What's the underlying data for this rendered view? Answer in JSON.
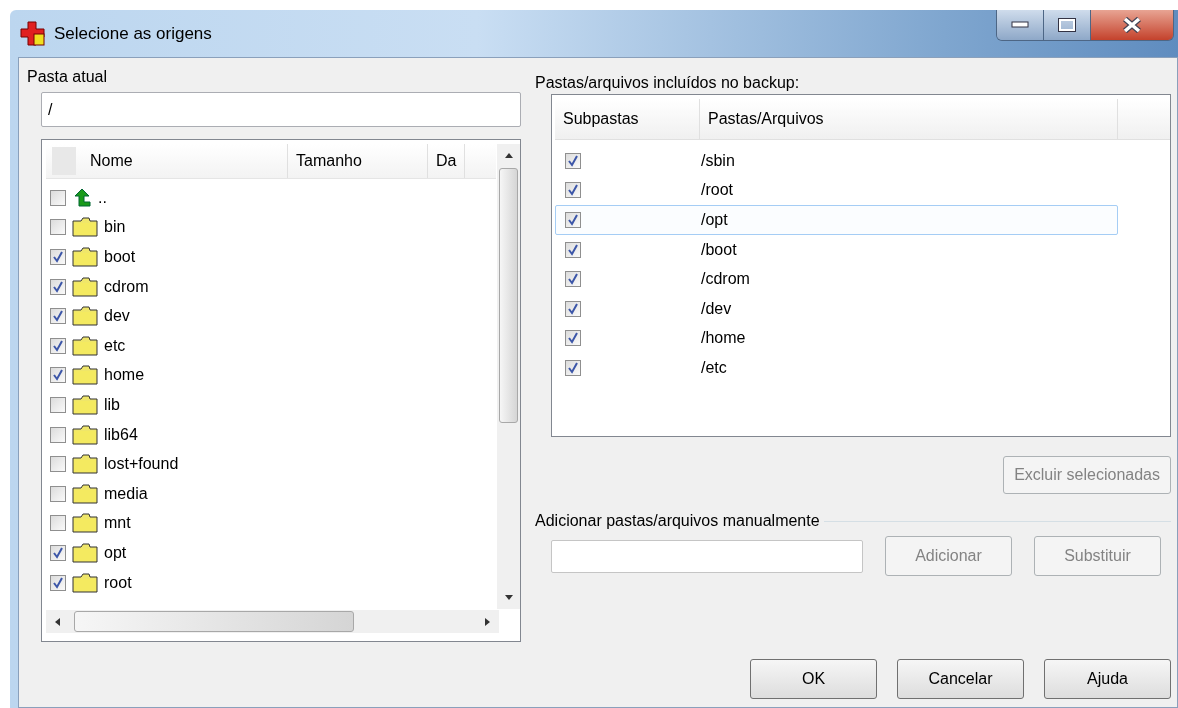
{
  "window": {
    "title": "Selecione as origens"
  },
  "current_folder": {
    "label": "Pasta atual",
    "value": "/"
  },
  "file_list": {
    "columns": [
      "Nome",
      "Tamanho",
      "Da"
    ],
    "rows": [
      {
        "kind": "parent",
        "name": "..",
        "checked": false
      },
      {
        "kind": "folder",
        "name": "bin",
        "checked": false
      },
      {
        "kind": "folder",
        "name": "boot",
        "checked": true
      },
      {
        "kind": "folder",
        "name": "cdrom",
        "checked": true
      },
      {
        "kind": "folder",
        "name": "dev",
        "checked": true
      },
      {
        "kind": "folder",
        "name": "etc",
        "checked": true
      },
      {
        "kind": "folder",
        "name": "home",
        "checked": true
      },
      {
        "kind": "folder",
        "name": "lib",
        "checked": false
      },
      {
        "kind": "folder",
        "name": "lib64",
        "checked": false
      },
      {
        "kind": "folder",
        "name": "lost+found",
        "checked": false
      },
      {
        "kind": "folder",
        "name": "media",
        "checked": false
      },
      {
        "kind": "folder",
        "name": "mnt",
        "checked": false
      },
      {
        "kind": "folder",
        "name": "opt",
        "checked": true
      },
      {
        "kind": "folder",
        "name": "root",
        "checked": true
      }
    ]
  },
  "backup_list": {
    "label": "Pastas/arquivos incluídos no backup:",
    "columns": [
      "Subpastas",
      "Pastas/Arquivos"
    ],
    "rows": [
      {
        "path": "/sbin",
        "subfolders": true,
        "selected": false
      },
      {
        "path": "/root",
        "subfolders": true,
        "selected": false
      },
      {
        "path": "/opt",
        "subfolders": true,
        "selected": true
      },
      {
        "path": "/boot",
        "subfolders": true,
        "selected": false
      },
      {
        "path": "/cdrom",
        "subfolders": true,
        "selected": false
      },
      {
        "path": "/dev",
        "subfolders": true,
        "selected": false
      },
      {
        "path": "/home",
        "subfolders": true,
        "selected": false
      },
      {
        "path": "/etc",
        "subfolders": true,
        "selected": false
      }
    ]
  },
  "remove_button": {
    "label": "Excluir selecionadas",
    "disabled": true
  },
  "manual_add": {
    "label": "Adicionar pastas/arquivos manualmente",
    "buttons": [
      {
        "label": "Adicionar",
        "disabled": true
      },
      {
        "label": "Substituir",
        "disabled": true
      }
    ]
  },
  "buttons": [
    {
      "label": "OK",
      "disabled": false
    },
    {
      "label": "Cancelar",
      "disabled": false
    },
    {
      "label": "Ajuda",
      "disabled": false
    }
  ]
}
